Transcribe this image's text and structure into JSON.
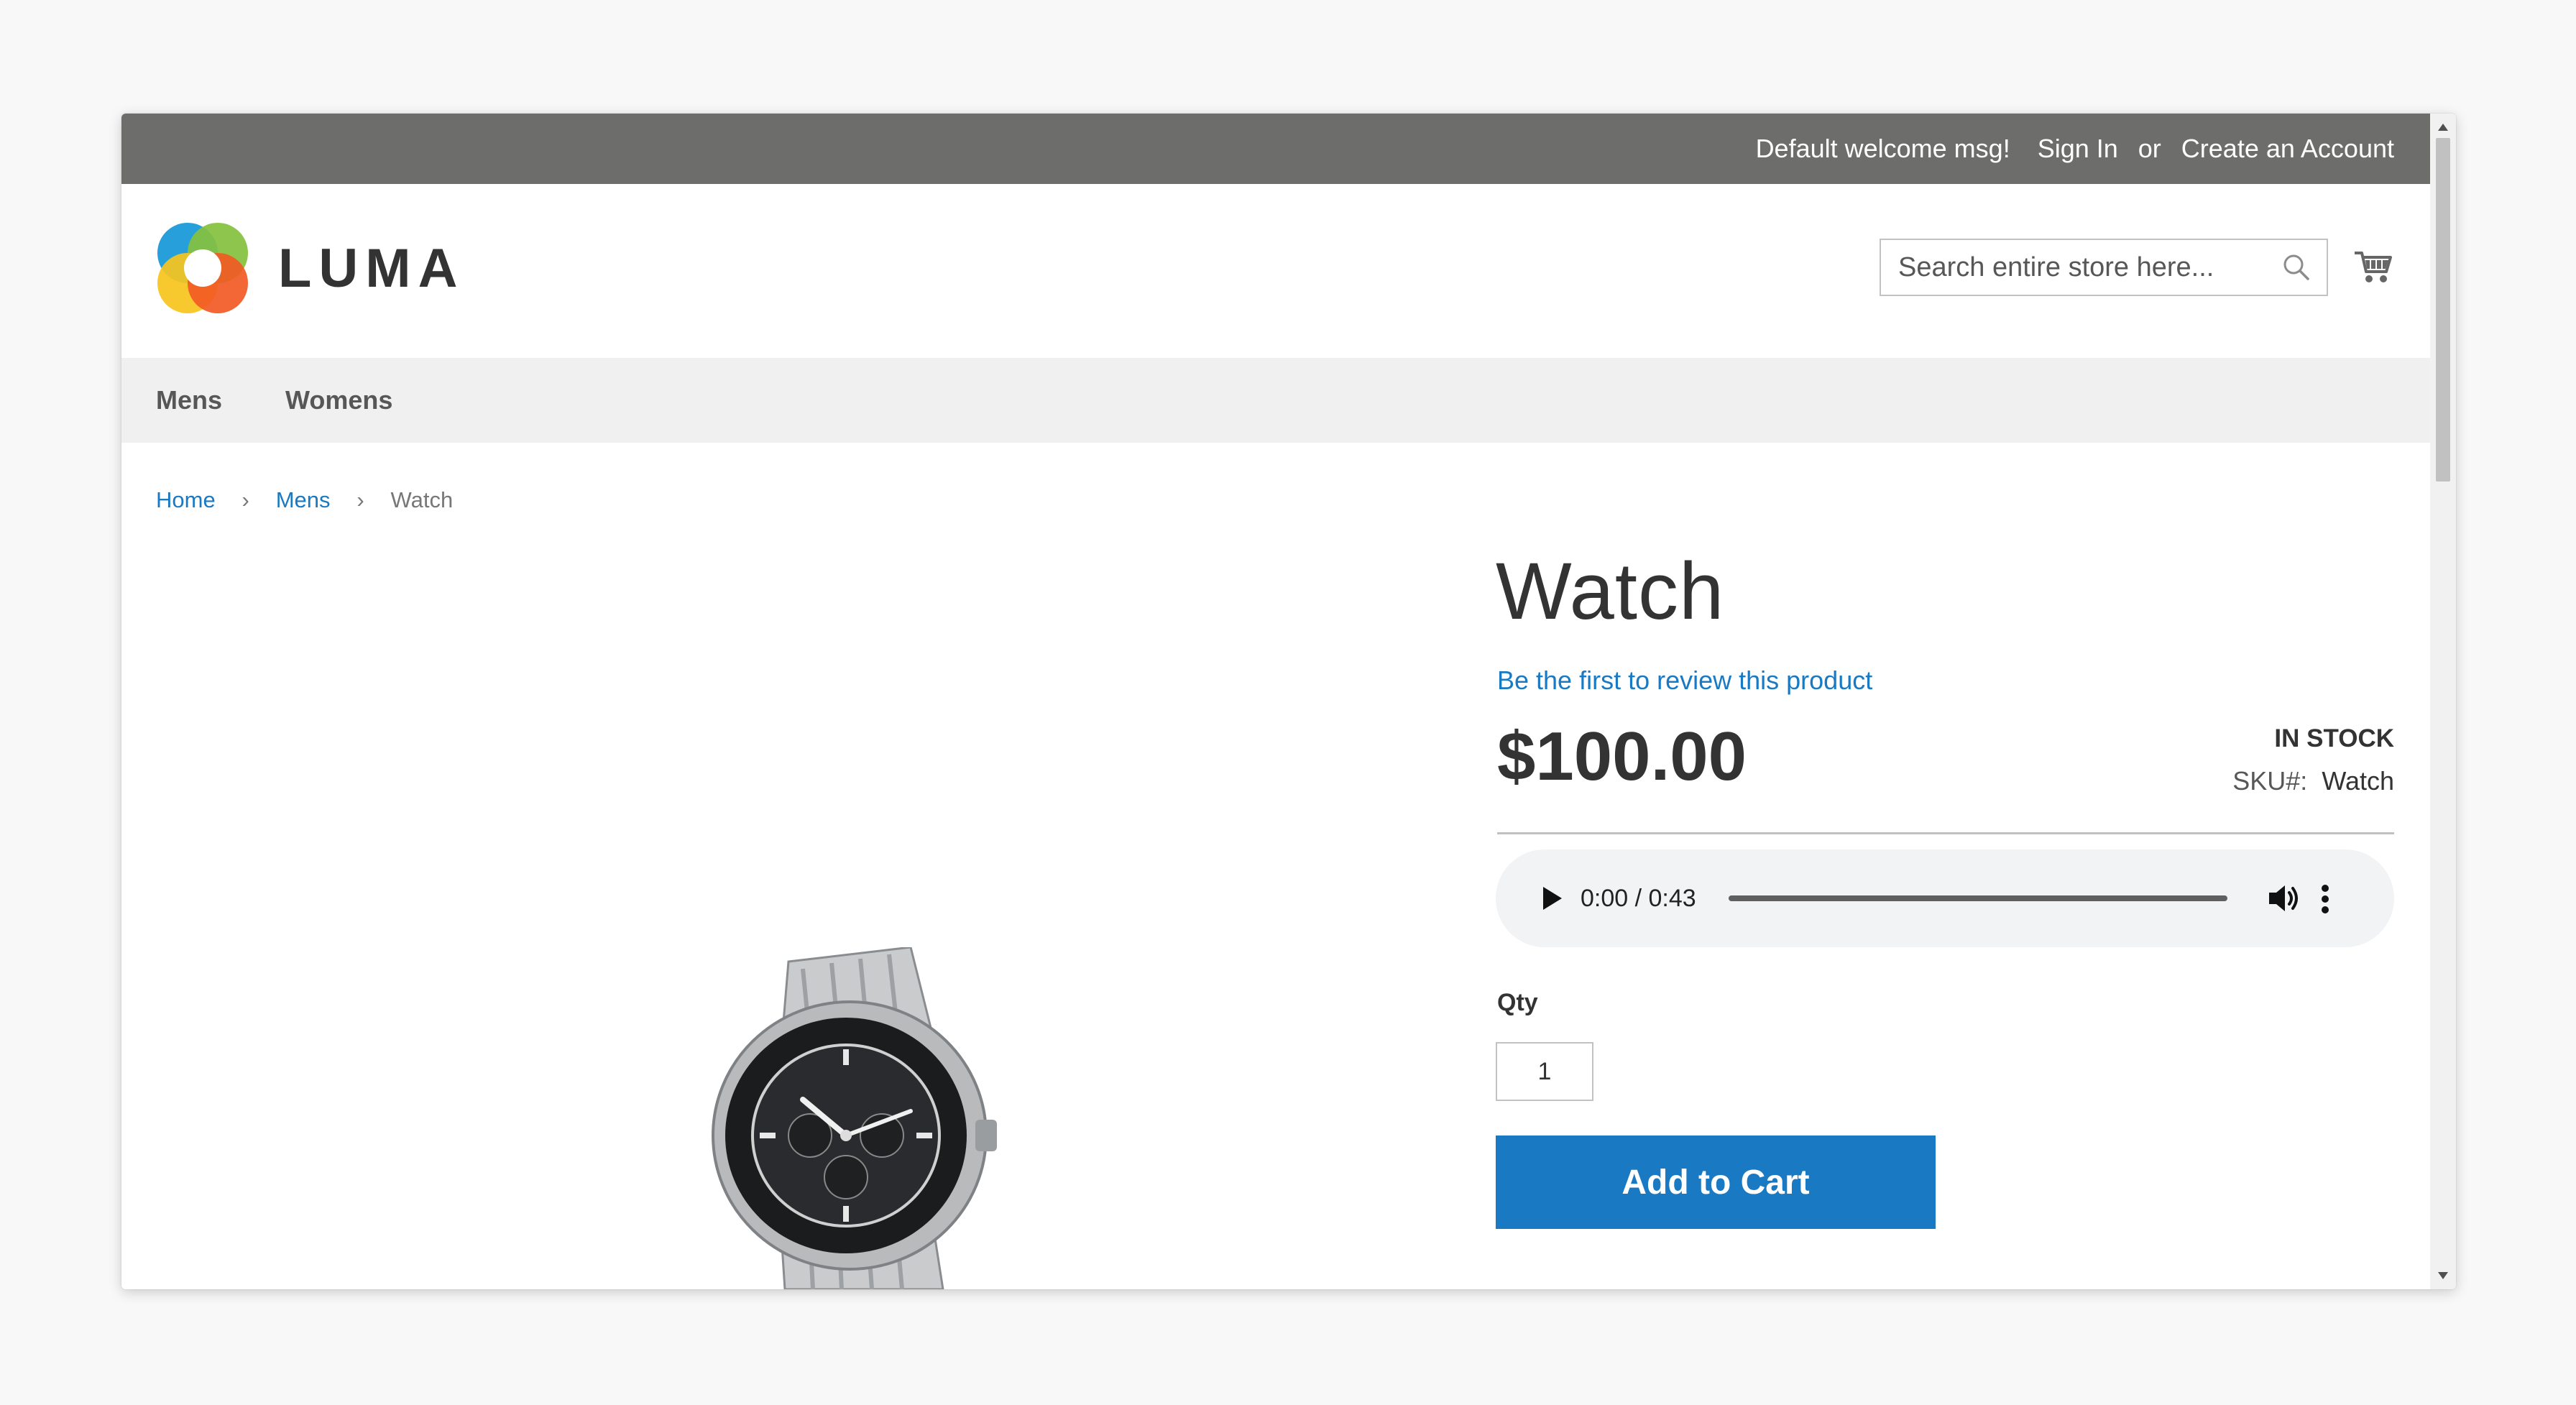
{
  "topbar": {
    "welcome": "Default welcome msg!",
    "sign_in": "Sign In",
    "or": "or",
    "create_account": "Create an Account"
  },
  "header": {
    "logo_text": "LUMA",
    "search_placeholder": "Search entire store here...",
    "search_value": "",
    "icons": [
      "search-icon",
      "cart-icon"
    ]
  },
  "nav": {
    "items": [
      {
        "label": "Mens"
      },
      {
        "label": "Womens"
      }
    ]
  },
  "breadcrumb": {
    "items": [
      "Home",
      "Mens",
      "Watch"
    ],
    "separator": "›"
  },
  "product": {
    "title": "Watch",
    "review_link": "Be the first to review this product",
    "price": "$100.00",
    "stock": "IN STOCK",
    "sku_label": "SKU#:",
    "sku_value": "Watch",
    "audio": {
      "time": "0:00 / 0:43",
      "progress": 0
    },
    "qty_label": "Qty",
    "qty_value": "1",
    "add_to_cart": "Add to Cart"
  },
  "colors": {
    "topbar": "#6d6e6c",
    "link": "#1979c3",
    "nav_bg": "#f0f0f0",
    "button": "#1979c3"
  }
}
